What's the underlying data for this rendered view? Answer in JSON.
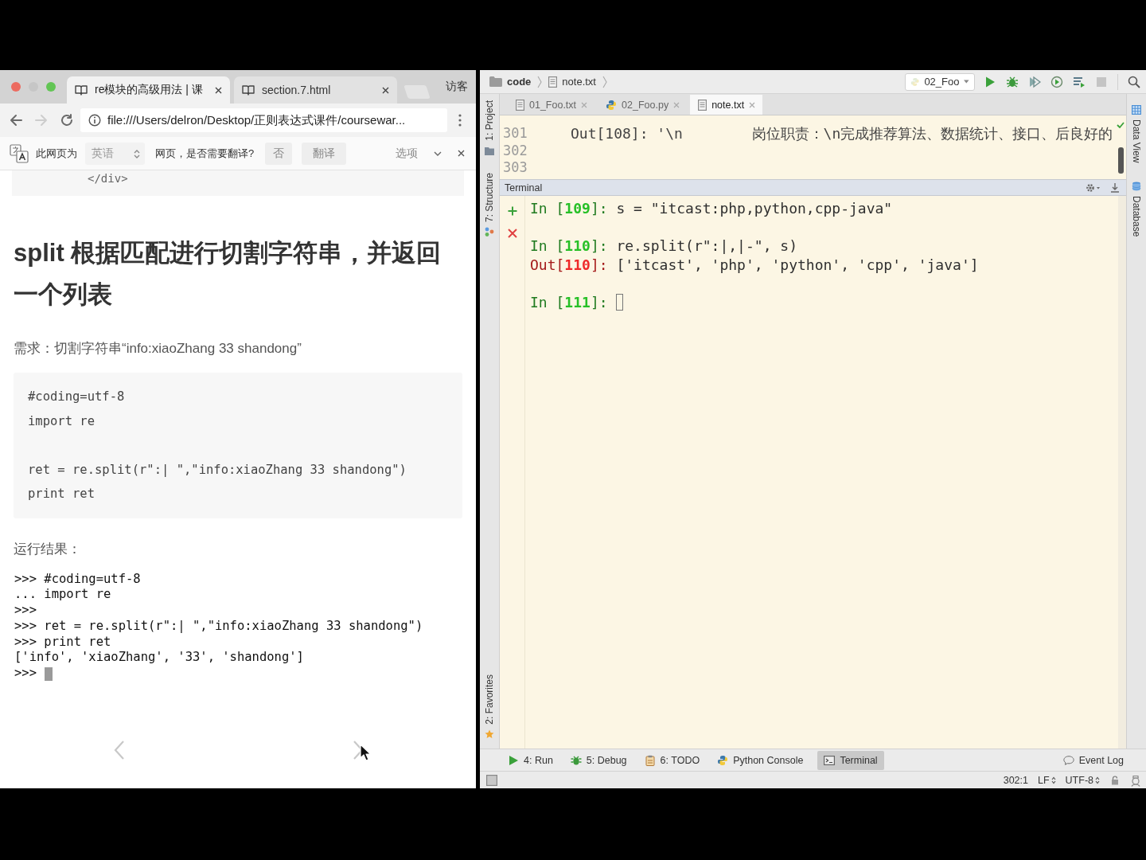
{
  "browser": {
    "tabs": [
      {
        "title": "re模块的高级用法 | 课",
        "selected": true
      },
      {
        "title": "section.7.html",
        "selected": false
      }
    ],
    "profile": "访客",
    "nav": [
      {
        "kind": "back",
        "disabled": false
      },
      {
        "kind": "forward",
        "disabled": true
      },
      {
        "kind": "reload",
        "disabled": false
      }
    ],
    "address": "file:///Users/delron/Desktop/正则表达式课件/coursewar...",
    "translate_bar": {
      "prefix": "此网页为",
      "language": "英语",
      "question": "网页，是否需要翻译?",
      "buttons": [
        "否",
        "翻译"
      ],
      "options": "选项"
    },
    "page": {
      "code_tail": "</div>",
      "heading": "split 根据匹配进行切割字符串，并返回一个列表",
      "requirement": "需求：切割字符串“info:xiaoZhang 33 shandong”",
      "code": [
        [
          "#coding=utf-8",
          "import re"
        ],
        [
          "ret = re.split(r\":| \",\"info:xiaoZhang 33 shandong\")",
          "print ret"
        ]
      ],
      "result_label": "运行结果：",
      "console": {
        "lines": [
          ">>> #coding=utf-8",
          "... import re",
          ">>>",
          ">>> ret = re.split(r\":| \",\"info:xiaoZhang 33 shandong\")",
          ">>> print ret",
          "['info', 'xiaoZhang', '33', 'shandong']",
          ">>>"
        ],
        "cursor": true
      }
    }
  },
  "ide": {
    "breadcrumbs": [
      {
        "kind": "folder",
        "label": "code"
      },
      {
        "kind": "file",
        "label": "note.txt"
      }
    ],
    "run_config": "02_Foo",
    "left_tools": [
      {
        "kind": "project",
        "label": "1: Project"
      },
      {
        "kind": "structure",
        "label": "7: Structure"
      }
    ],
    "left_bottom_tools": [
      {
        "kind": "favorites",
        "label": "2: Favorites"
      }
    ],
    "right_tools": [
      {
        "kind": "grid",
        "label": "Data View"
      },
      {
        "kind": "database",
        "label": "Database"
      }
    ],
    "editor_tabs": [
      {
        "kind": "text",
        "label": "01_Foo.txt",
        "selected": false
      },
      {
        "kind": "python",
        "label": "02_Foo.py",
        "selected": false
      },
      {
        "kind": "text",
        "label": "note.txt",
        "selected": true
      }
    ],
    "editor_lines": [
      {
        "number": "301",
        "text": "Out[108]: '\\n        岗位职责：\\n完成推荐算法、数据统计、接口、后良好的"
      },
      {
        "number": "302"
      },
      {
        "number": "303"
      }
    ],
    "terminal": {
      "title": "Terminal",
      "groups": [
        [
          {
            "kind": "in",
            "prompt": [
              "In [",
              "109",
              "]:"
            ],
            "code": "s = \"itcast:php,python,cpp-java\"",
            "cursor": false
          }
        ],
        [
          {
            "kind": "in",
            "prompt": [
              "In [",
              "110",
              "]:"
            ],
            "code": "re.split(r\":|,|-\", s)",
            "cursor": false
          },
          {
            "kind": "out",
            "prompt": [
              "Out[",
              "110",
              "]:"
            ],
            "code": "['itcast', 'php', 'python', 'cpp', 'java']",
            "cursor": false
          }
        ],
        [
          {
            "kind": "in",
            "prompt": [
              "In [",
              "111",
              "]:"
            ],
            "cursor": true
          }
        ]
      ]
    },
    "bottom_tools": [
      {
        "kind": "run",
        "label": "4: Run",
        "selected": false
      },
      {
        "kind": "debug",
        "label": "5: Debug",
        "selected": false
      },
      {
        "kind": "todo",
        "label": "6: TODO",
        "selected": false
      },
      {
        "kind": "python",
        "label": "Python Console",
        "selected": false
      },
      {
        "kind": "terminal",
        "label": "Terminal",
        "selected": true
      }
    ],
    "event_log": "Event Log",
    "status": {
      "position": "302:1",
      "line_separator": "LF",
      "encoding": "UTF-8"
    }
  }
}
